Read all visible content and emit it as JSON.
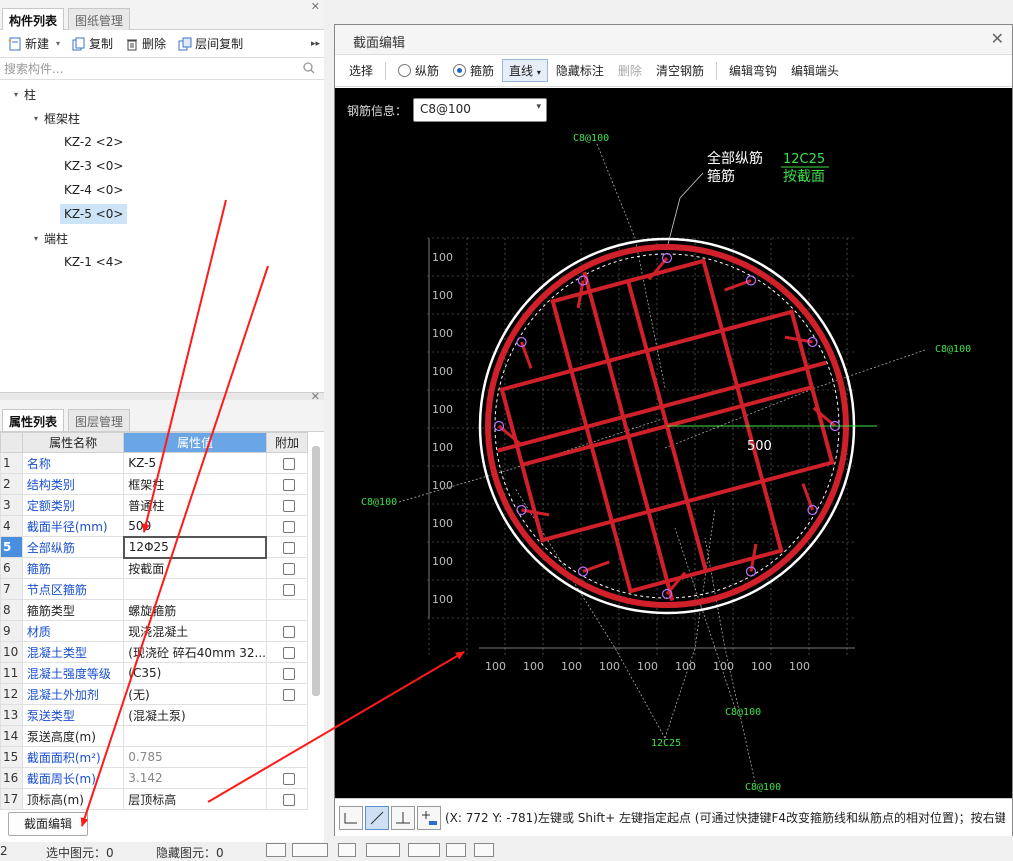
{
  "left_tabs": [
    "构件列表",
    "图纸管理"
  ],
  "toolbar": {
    "new": "新建",
    "copy": "复制",
    "delete": "删除",
    "floor_copy": "层间复制",
    "more": "▸▸"
  },
  "search_placeholder": "搜索构件...",
  "tree": {
    "root": "柱",
    "group1": "框架柱",
    "items1": [
      "KZ-2 <2>",
      "KZ-3 <0>",
      "KZ-4 <0>",
      "KZ-5 <0>"
    ],
    "group2": "端柱",
    "items2": [
      "KZ-1 <4>"
    ]
  },
  "prop_tabs": [
    "属性列表",
    "图层管理"
  ],
  "prop_headers": {
    "name": "属性名称",
    "value": "属性值",
    "extra": "附加"
  },
  "props": [
    {
      "n": "1",
      "name": "名称",
      "value": "KZ-5"
    },
    {
      "n": "2",
      "name": "结构类别",
      "value": "框架柱"
    },
    {
      "n": "3",
      "name": "定额类别",
      "value": "普通柱"
    },
    {
      "n": "4",
      "name": "截面半径(mm)",
      "value": "500"
    },
    {
      "n": "5",
      "name": "全部纵筋",
      "value": "12Φ25"
    },
    {
      "n": "6",
      "name": "箍筋",
      "value": "按截面"
    },
    {
      "n": "7",
      "name": "节点区箍筋",
      "value": ""
    },
    {
      "n": "8",
      "name": "箍筋类型",
      "value": "螺旋箍筋"
    },
    {
      "n": "9",
      "name": "材质",
      "value": "现浇混凝土"
    },
    {
      "n": "10",
      "name": "混凝土类型",
      "value": "(现浇砼 碎石40mm 32..."
    },
    {
      "n": "11",
      "name": "混凝土强度等级",
      "value": "(C35)"
    },
    {
      "n": "12",
      "name": "混凝土外加剂",
      "value": "(无)"
    },
    {
      "n": "13",
      "name": "泵送类型",
      "value": "(混凝土泵)"
    },
    {
      "n": "14",
      "name": "泵送高度(m)",
      "value": ""
    },
    {
      "n": "15",
      "name": "截面面积(m²)",
      "value": "0.785"
    },
    {
      "n": "16",
      "name": "截面周长(m)",
      "value": "3.142"
    },
    {
      "n": "17",
      "name": "顶标高(m)",
      "value": "层顶标高"
    }
  ],
  "edit_button": "截面编辑",
  "status": {
    "left": "2",
    "selected": "选中图元：0",
    "hidden": "隐藏图元：0"
  },
  "dialog": {
    "title": "截面编辑",
    "toolbar": [
      "选择",
      "纵筋",
      "箍筋",
      "直线",
      "隐藏标注",
      "删除",
      "清空钢筋",
      "编辑弯钩",
      "编辑端头"
    ],
    "info_label": "钢筋信息：",
    "info_value": "C8@100",
    "coord_text": "(X: 772 Y: -781)左键或 Shift+ 左键指定起点 (可通过快捷键F4改变箍筋线和纵筋点的相对位置)；按右键"
  },
  "drawing": {
    "label_long": "全部纵筋",
    "label_stirrup": "箍筋",
    "long_value": "12C25",
    "stirrup_value": "按截面",
    "radius": "500",
    "tag_c8": "C8@100",
    "tag_12c25": "12C25",
    "grid_label": "100"
  },
  "colors": {
    "rebar": "#d0202a",
    "dim": "#7a7a7a",
    "green": "#3fe04a",
    "white": "#ffffff"
  }
}
